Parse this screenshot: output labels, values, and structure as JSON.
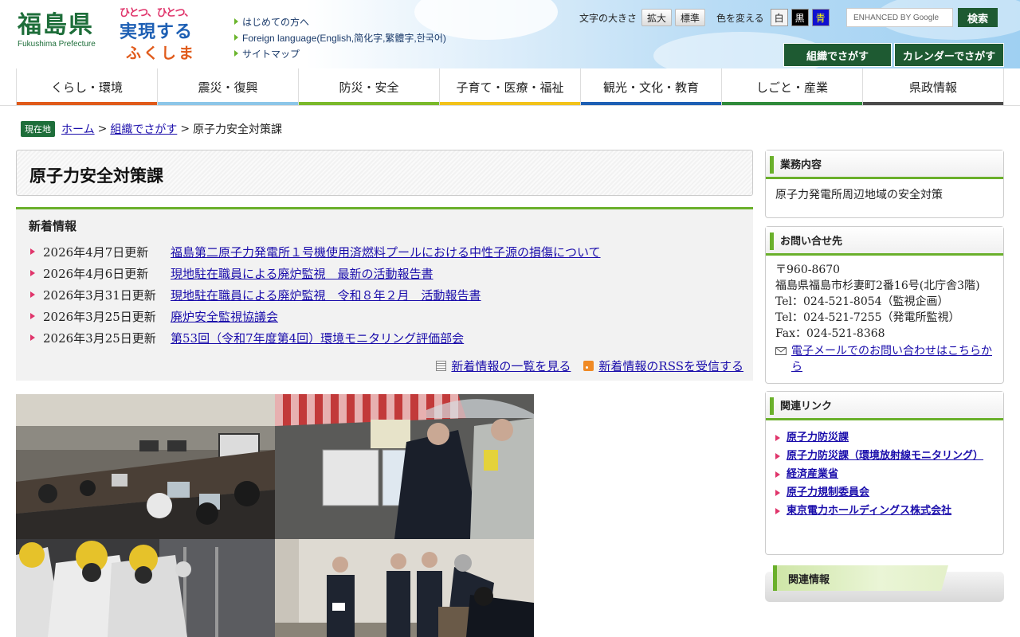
{
  "header": {
    "logo_kanji": "福島県",
    "logo_roman": "Fukushima Prefecture",
    "slogan_line1": "ひとつ、ひとつ、",
    "slogan_line2": "実現する",
    "slogan_line3": "ふくしま",
    "links": [
      "はじめての方へ",
      "Foreign language(English,简化字,繁體字,한국어)",
      "サイトマップ"
    ],
    "font_size_label": "文字の大きさ",
    "font_enlarge": "拡大",
    "font_standard": "標準",
    "color_label": "色を変える",
    "color_white": "白",
    "color_black": "黒",
    "color_blue": "青",
    "search_placeholder": "ENHANCED BY Google",
    "search_button": "検索",
    "org_search_button": "組織でさがす",
    "calendar_button": "カレンダーでさがす"
  },
  "gnav": [
    {
      "label": "くらし・環境",
      "color": "#e05a1a"
    },
    {
      "label": "震災・復興",
      "color": "#8cc6e8"
    },
    {
      "label": "防災・安全",
      "color": "#7ab92a"
    },
    {
      "label": "子育て・医療・福祉",
      "color": "#f2c21a"
    },
    {
      "label": "観光・文化・教育",
      "color": "#1d5fb4"
    },
    {
      "label": "しごと・産業",
      "color": "#2f8a3a"
    },
    {
      "label": "県政情報",
      "color": "#4a4a4a"
    }
  ],
  "breadcrumb": {
    "here_label": "現在地",
    "home": "ホーム",
    "org": "組織でさがす",
    "current": "原子力安全対策課",
    "sep": ">"
  },
  "page_title": "原子力安全対策課",
  "news": {
    "heading": "新着情報",
    "items": [
      {
        "date": "2026年4月7日更新",
        "title": "福島第二原子力発電所１号機使用済燃料プールにおける中性子源の損傷について"
      },
      {
        "date": "2026年4月6日更新",
        "title": "現地駐在職員による廃炉監視　最新の活動報告書"
      },
      {
        "date": "2026年3月31日更新",
        "title": "現地駐在職員による廃炉監視　令和８年２月　活動報告書"
      },
      {
        "date": "2026年3月25日更新",
        "title": "廃炉安全監視協議会"
      },
      {
        "date": "2026年3月25日更新",
        "title": "第53回（令和7年度第4回）環境モニタリング評価部会"
      }
    ],
    "list_link": "新着情報の一覧を見る",
    "rss_link": "新着情報のRSSを受信する"
  },
  "sidebar": {
    "duty_heading": "業務内容",
    "duty_text": "原子力発電所周辺地域の安全対策",
    "contact_heading": "お問い合せ先",
    "contact_lines": [
      "〒960-8670",
      "福島県福島市杉妻町2番16号(北庁舎3階)",
      "Tel：024-521-8054（監視企画）",
      "Tel：024-521-7255（発電所監視）",
      "Fax：024-521-8368"
    ],
    "contact_mail": "電子メールでのお問い合わせはこちらから",
    "links_heading": "関連リンク",
    "links": [
      "原子力防災課",
      "原子力防災課（環境放射線モニタリング）",
      "経済産業省",
      "原子力規制委員会",
      "東京電力ホールディングス株式会社"
    ],
    "related_info_heading": "関連情報"
  }
}
